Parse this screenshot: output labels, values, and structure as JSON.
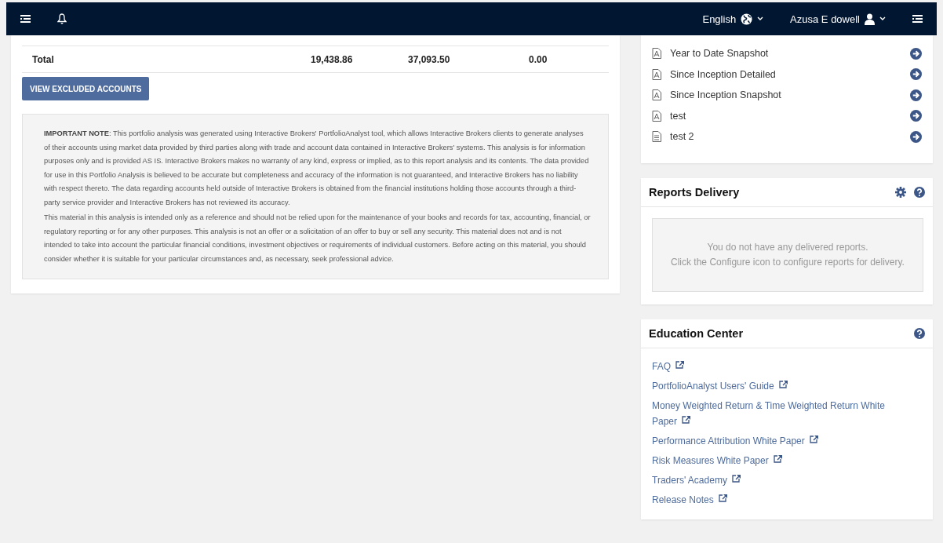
{
  "navbar": {
    "language": "English",
    "user": "Azusa E dowell"
  },
  "summary_table": {
    "total_row": {
      "label": "Total",
      "column_2": "19,438.86",
      "column_3": "37,093.50",
      "column_4": "0.00"
    }
  },
  "view_excluded_button": "VIEW EXCLUDED ACCOUNTS",
  "important_note": [
    "**IMPORTANT NOTE**: This portfolio analysis was generated using Interactive Brokers' PortfolioAnalyst tool, which allows Interactive Brokers clients to generate analyses of their accounts using market data provided by third parties along with trade and account data contained in Interactive Brokers' systems. This analysis is for information purposes only and is provided AS IS. Interactive Brokers makes no warranty of any kind, express or implied, as to this report analysis and its contents. The data provided for use in this Portfolio Analysis is believed to be accurate but completeness and accuracy of the information is not guaranteed, and Interactive Brokers has no liability with respect thereto. The data regarding accounts held outside of Interactive Brokers is obtained from the financial institutions holding those accounts through a third-party service provider and Interactive Brokers has not reviewed its accuracy.",
    "This material in this analysis is intended only as a reference and should not be relied upon for the maintenance of your books and records for tax, accounting, financial, or regulatory reporting or for any other purposes. This analysis is not an offer or a solicitation of an offer to buy or sell any security. This material does not and is not intended to take into account the particular financial conditions, investment objectives or requirements of individual customers. Before acting on this material, you should consider whether it is suitable for your particular circumstances and, as necessary, seek professional advice."
  ],
  "reports": [
    {
      "label": "Year to Date Snapshot",
      "kind": "pdf"
    },
    {
      "label": "Since Inception Detailed",
      "kind": "pdf"
    },
    {
      "label": "Since Inception Snapshot",
      "kind": "pdf"
    },
    {
      "label": "test",
      "kind": "pdf"
    },
    {
      "label": "test 2",
      "kind": "document"
    }
  ],
  "reports_delivery": {
    "title": "Reports Delivery",
    "empty_message": [
      "You do not have any delivered reports.",
      "Click the Configure icon to configure reports for delivery."
    ]
  },
  "education_center": {
    "title": "Education Center",
    "links": [
      "FAQ",
      "PortfolioAnalyst Users' Guide",
      "Money Weighted Return & Time Weighted Return White Paper",
      "Performance Attribution White Paper",
      "Risk Measures White Paper",
      "Traders' Academy",
      "Release Notes"
    ]
  }
}
